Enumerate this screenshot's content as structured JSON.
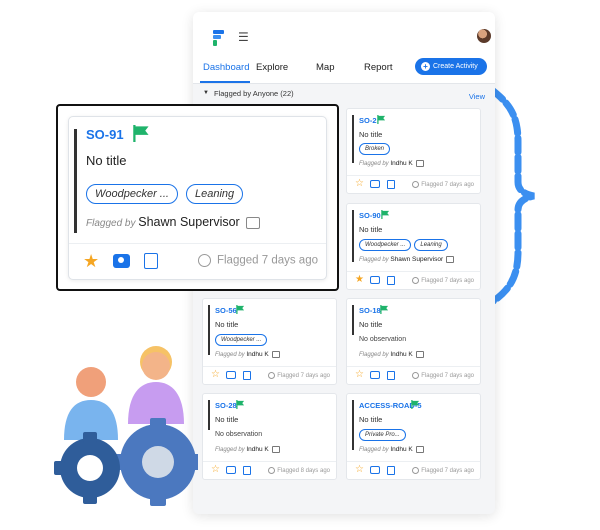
{
  "app": {
    "nav": {
      "tabs": [
        {
          "label": "Dashboard",
          "active": true
        },
        {
          "label": "Explore"
        },
        {
          "label": "Map"
        },
        {
          "label": "Report"
        }
      ],
      "create_label": "Create Activity"
    },
    "section": {
      "title": "Flagged by Anyone (22)",
      "view_label": "View"
    }
  },
  "featured_card": {
    "id": "SO-91",
    "title": "No title",
    "tags": [
      "Woodpecker ...",
      "Leaning"
    ],
    "flagged_prefix": "Flagged by",
    "flagged_by": "Shawn Supervisor",
    "age": "Flagged 7 days ago"
  },
  "cards": [
    {
      "id": "SO-2",
      "title": "No title",
      "tags": [
        "Broken"
      ],
      "flagged_prefix": "Flagged by",
      "flagged_by": "Indhu K",
      "age": "Flagged 7 days ago"
    },
    {
      "id": "SO-90",
      "title": "No title",
      "tags": [
        "Woodpecker ...",
        "Leaning"
      ],
      "flagged_prefix": "Flagged by",
      "flagged_by": "Shawn Supervisor",
      "age": "Flagged 7 days ago"
    },
    {
      "id": "SO-56",
      "title": "No title",
      "tags": [
        "Woodpecker ..."
      ],
      "flagged_prefix": "Flagged by",
      "flagged_by": "Indhu K",
      "age": "Flagged 7 days ago"
    },
    {
      "id": "SO-18",
      "title": "No title",
      "observation": "No observation",
      "flagged_prefix": "Flagged by",
      "flagged_by": "Indhu K",
      "age": "Flagged 7 days ago"
    },
    {
      "id": "SO-28",
      "title": "No title",
      "observation": "No observation",
      "flagged_prefix": "Flagged by",
      "flagged_by": "Indhu K",
      "age": "Flagged 8 days ago"
    },
    {
      "id": "ACCESS-ROAD-5",
      "title": "No title",
      "tags": [
        "Private Pro..."
      ],
      "flagged_prefix": "Flagged by",
      "flagged_by": "Indhu K",
      "age": "Flagged 7 days ago"
    }
  ],
  "colors": {
    "accent": "#1a73e8",
    "flag": "#1fb36b",
    "star": "#f5a623",
    "bracket": "#3b8ff0"
  }
}
